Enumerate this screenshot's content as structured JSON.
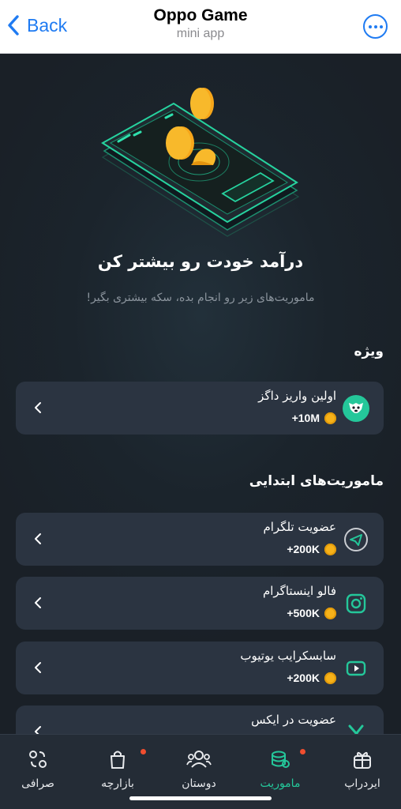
{
  "header": {
    "back_label": "Back",
    "title": "Oppo Game",
    "subtitle": "mini app",
    "more_icon": "more-icon"
  },
  "hero": {
    "headline": "درآمد خودت رو بیشتر کن",
    "subline": "ماموریت‌های زیر رو انجام بده، سکه بیشتری بگیر!"
  },
  "sections": {
    "special": "ویژه",
    "basic": "ماموریت‌های ابتدایی"
  },
  "tasks": [
    {
      "name": "اولین واریز داگز",
      "reward": "+10M",
      "icon": "dogs-icon"
    },
    {
      "name": "عضویت تلگرام",
      "reward": "+200K",
      "icon": "telegram-icon"
    },
    {
      "name": "فالو اینستاگرام",
      "reward": "+500K",
      "icon": "instagram-icon"
    },
    {
      "name": "سابسکرایب یوتیوب",
      "reward": "+200K",
      "icon": "youtube-icon"
    },
    {
      "name": "عضویت در ایکس",
      "reward": "",
      "icon": "x-icon"
    }
  ],
  "nav": [
    {
      "label": "ایردراپ",
      "icon": "gift-icon",
      "active": false,
      "badge": false
    },
    {
      "label": "ماموریت",
      "icon": "coins-icon",
      "active": true,
      "badge": true
    },
    {
      "label": "دوستان",
      "icon": "friends-icon",
      "active": false,
      "badge": false
    },
    {
      "label": "بازارچه",
      "icon": "bag-icon",
      "active": false,
      "badge": true
    },
    {
      "label": "صرافی",
      "icon": "exchange-icon",
      "active": false,
      "badge": false
    }
  ],
  "colors": {
    "accent": "#24c79a",
    "coin": "#f6b21a",
    "badge": "#f04e2f",
    "card": "#2b3441",
    "link": "#1f7bf2"
  }
}
